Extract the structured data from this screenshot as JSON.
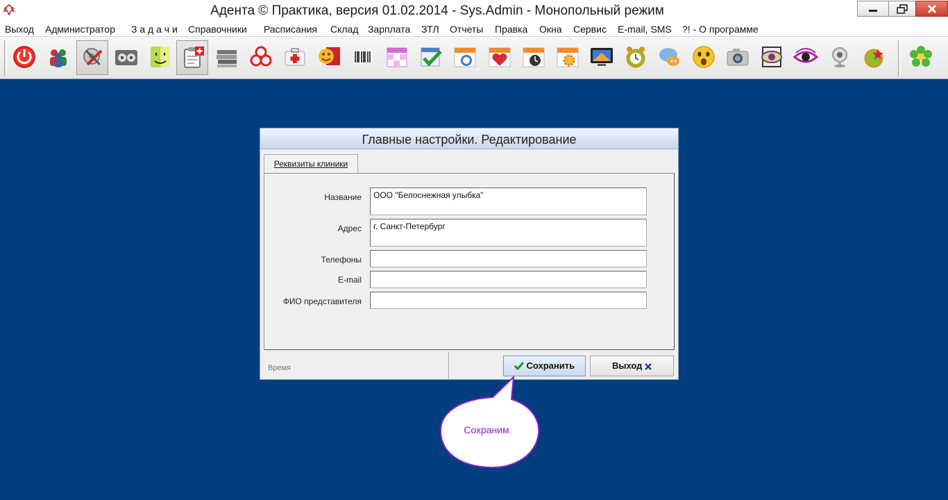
{
  "window": {
    "title": "Адента © Практика, версия 01.02.2014 - Sys.Admin - Монопольный режим"
  },
  "menu": [
    {
      "label": "Выход"
    },
    {
      "label": "Администратор"
    },
    {
      "label": "З а д а ч и"
    },
    {
      "label": "Справочники"
    },
    {
      "label": "Расписания"
    },
    {
      "label": "Склад"
    },
    {
      "label": "Зарплата"
    },
    {
      "label": "ЗТЛ"
    },
    {
      "label": "Отчеты"
    },
    {
      "label": "Правка"
    },
    {
      "label": "Окна"
    },
    {
      "label": "Сервис"
    },
    {
      "label": "E-mail, SMS"
    },
    {
      "label": "?! - О программе"
    }
  ],
  "toolbar": {
    "icons": [
      "power-icon",
      "users-icon",
      "settings-tools-icon",
      "film-icon",
      "finder-icon",
      "clipboard-add-icon",
      "books-icon",
      "biohazard-icon",
      "first-aid-icon",
      "emoji-card-icon",
      "barcode-icon",
      "schedule-grid-icon",
      "calendar-check-icon",
      "calendar-clock-icon",
      "calendar-heart-icon",
      "calendar-timer-icon",
      "calendar-gear-icon",
      "monitor-icon",
      "alarm-clock-icon",
      "chat-bubble-icon",
      "surprised-face-icon",
      "camera-icon",
      "eye-frame-icon",
      "eye-icon",
      "webcam-icon",
      "star-badge-icon",
      "icq-flower-icon"
    ]
  },
  "dialog": {
    "title": "Главные настройки. Редактирование",
    "tab_label": "Реквизиты клиники",
    "fields": {
      "name": {
        "label": "Название",
        "value": "ООО \"Белоснежная улыбка\""
      },
      "address": {
        "label": "Адрес",
        "value": "г. Санкт-Петербург"
      },
      "phones": {
        "label": "Телефоны",
        "value": ""
      },
      "email": {
        "label": "E-mail",
        "value": ""
      },
      "representative": {
        "label": "ФИО представителя",
        "value": ""
      }
    },
    "status_text": "Время",
    "save_label": "Сохранить",
    "exit_label": "Выход"
  },
  "callout": {
    "text": "Сохраним",
    "color": "#8a1fc9"
  },
  "colors": {
    "desktop": "#003e7e",
    "save_check": "#1d8a2b",
    "exit_x": "#1f3f8a"
  }
}
